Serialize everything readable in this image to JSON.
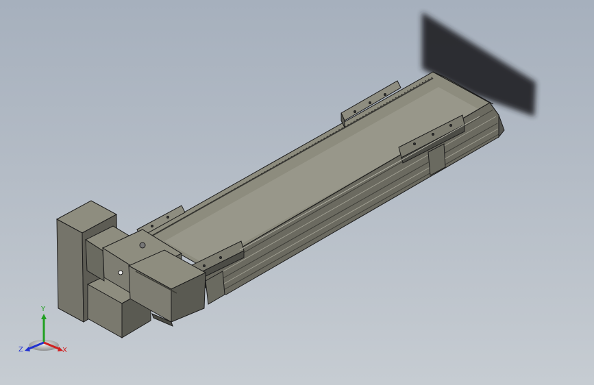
{
  "triad": {
    "x_label": "X",
    "y_label": "Y",
    "z_label": "Z",
    "x_color": "#d02020",
    "y_color": "#20a020",
    "z_color": "#2030d0"
  },
  "colors": {
    "background_top": "#a6b0bd",
    "background_bottom": "#c6ccd2",
    "body_top": "#8b8a7c",
    "body_side": "#6e6d62",
    "body_dark": "#4a4a44",
    "outline": "#1c1c1c",
    "shadow": "#1f2226"
  }
}
